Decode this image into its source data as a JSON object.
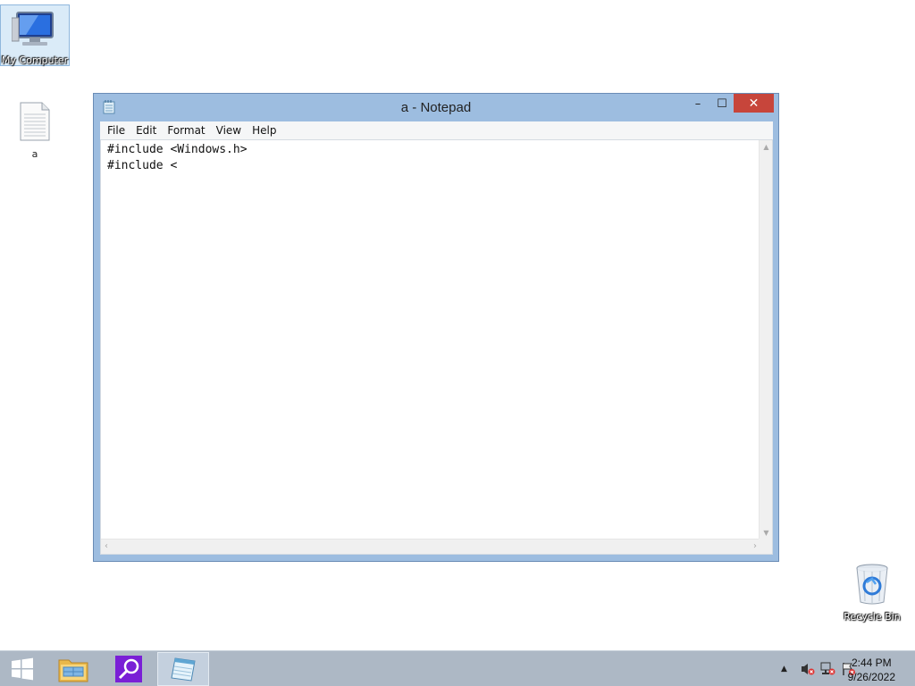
{
  "desktop": {
    "icons": [
      {
        "label": "My Computer",
        "icon": "computer-icon"
      },
      {
        "label": "a",
        "icon": "text-file-icon"
      },
      {
        "label": "Recycle Bin",
        "icon": "recycle-bin-icon"
      }
    ]
  },
  "window": {
    "title": "a - Notepad",
    "icon": "notepad-icon",
    "controls": {
      "minimize": "–",
      "maximize": "☐",
      "close": "✕"
    },
    "menu": [
      "File",
      "Edit",
      "Format",
      "View",
      "Help"
    ],
    "content": "#include <Windows.h>\n#include <"
  },
  "taskbar": {
    "items": [
      {
        "name": "start",
        "icon": "windows-logo-icon"
      },
      {
        "name": "file-explorer",
        "icon": "folder-icon"
      },
      {
        "name": "search",
        "icon": "magnifier-icon"
      },
      {
        "name": "notepad",
        "icon": "notepad-icon",
        "active": true
      }
    ],
    "tray": {
      "icons": [
        "chevron-up-icon",
        "volume-muted-icon",
        "network-error-icon",
        "action-center-error-icon"
      ],
      "time": "2:44 PM",
      "date": "9/26/2022"
    }
  },
  "colors": {
    "window_frame": "#9dbde0",
    "close_button": "#c7453b",
    "taskbar": "#adb8c5",
    "search_tile": "#7a1fd6"
  }
}
